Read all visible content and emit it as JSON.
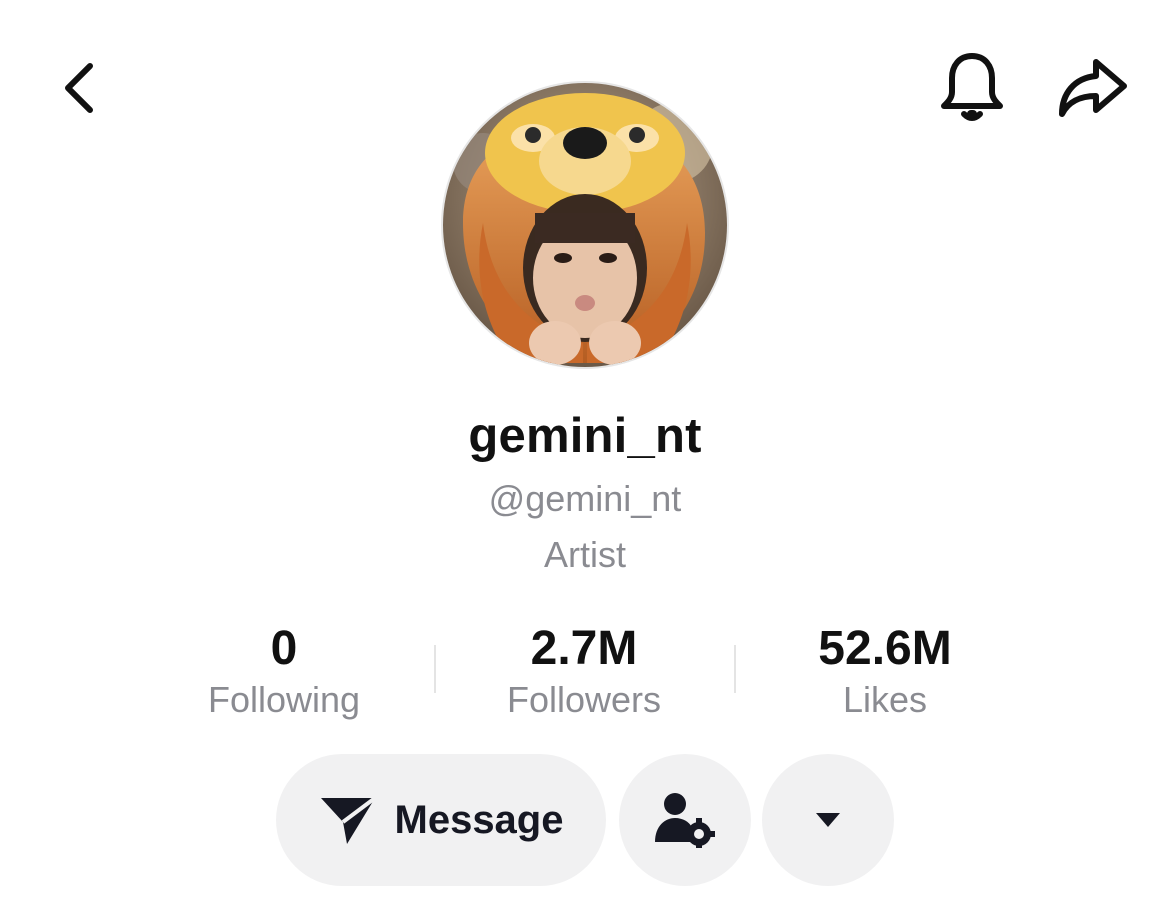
{
  "header": {
    "back_icon": "chevron-left-icon",
    "bell_icon": "bell-icon",
    "share_icon": "share-arrow-icon"
  },
  "profile": {
    "avatar": "profile-photo",
    "display_name": "gemini_nt",
    "handle": "@gemini_nt",
    "category": "Artist"
  },
  "stats": [
    {
      "value": "0",
      "label": "Following"
    },
    {
      "value": "2.7M",
      "label": "Followers"
    },
    {
      "value": "52.6M",
      "label": "Likes"
    }
  ],
  "actions": {
    "message_label": "Message",
    "message_icon": "send-icon",
    "add_friend_icon": "user-settings-icon",
    "more_icon": "caret-down-icon"
  },
  "colors": {
    "text_primary": "#111111",
    "text_secondary": "#8a8b91",
    "button_bg": "#f1f1f2"
  }
}
